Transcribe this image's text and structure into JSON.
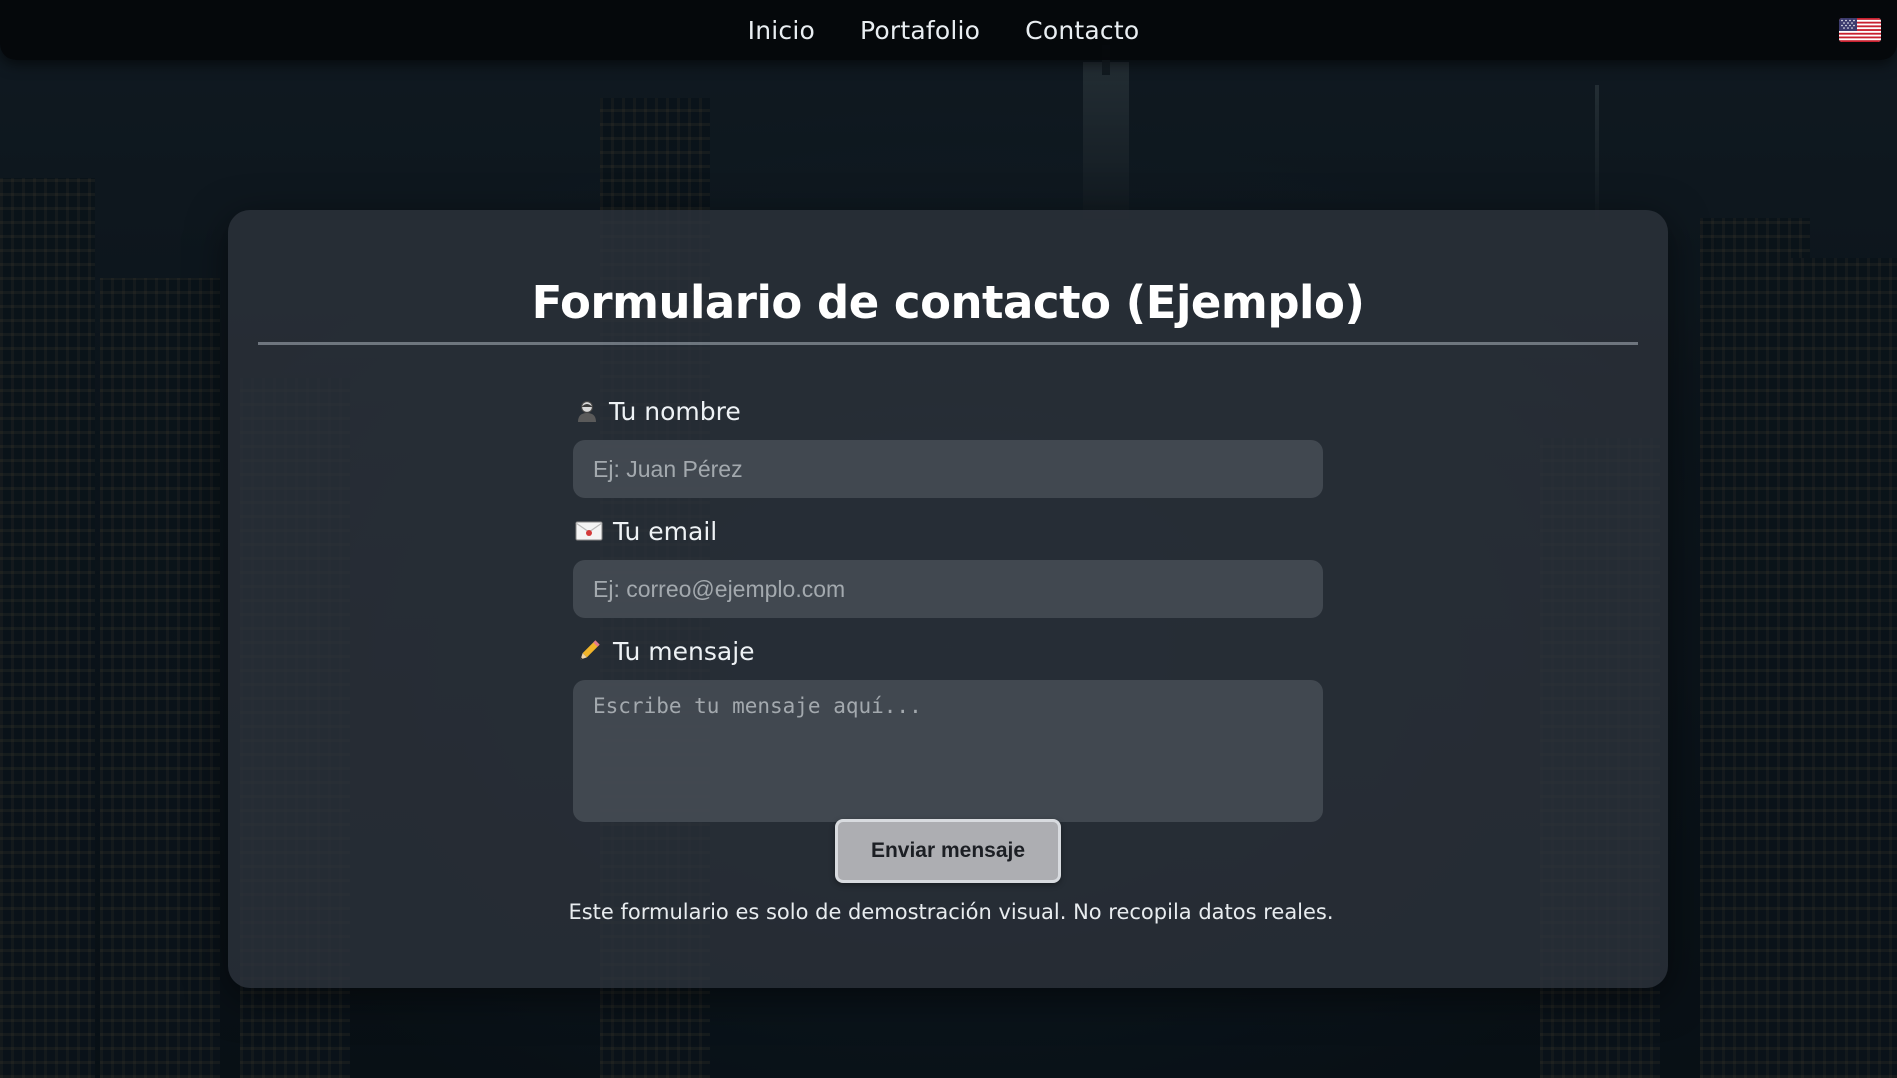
{
  "nav": {
    "links": [
      "Inicio",
      "Portafolio",
      "Contacto"
    ],
    "language_icon": "us-flag-icon"
  },
  "form": {
    "title": "Formulario de contacto (Ejemplo)",
    "name": {
      "icon": "person-icon",
      "label": "Tu nombre",
      "placeholder": "Ej: Juan Pérez",
      "value": ""
    },
    "email": {
      "icon": "envelope-icon",
      "label": "Tu email",
      "placeholder": "Ej: correo@ejemplo.com",
      "value": ""
    },
    "message": {
      "icon": "pencil-icon",
      "label": "Tu mensaje",
      "placeholder": "Escribe tu mensaje aquí...",
      "value": ""
    },
    "submit_label": "Enviar mensaje",
    "disclaimer": "Este formulario es solo de demostración visual. No recopila datos reales."
  },
  "colors": {
    "nav_bg": "#04070a",
    "card_bg": "#2c323a",
    "input_bg": "#464c54",
    "button_bg": "#adaeb2",
    "text": "#ffffff"
  }
}
